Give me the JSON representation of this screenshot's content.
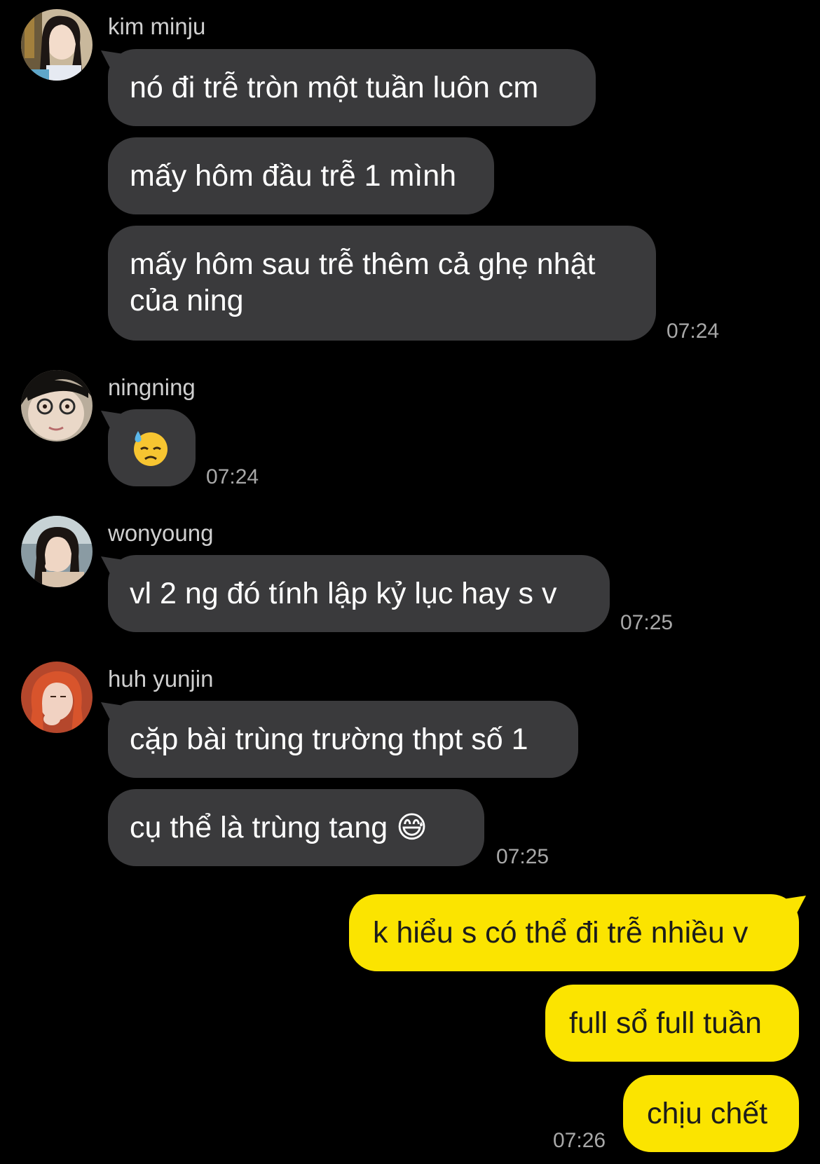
{
  "messages_incoming": [
    {
      "sender": "kim minju",
      "bubbles": [
        "nó đi trễ tròn một tuần luôn cm",
        "mấy hôm đầu trễ 1 mình",
        "mấy hôm sau trễ thêm cả ghẹ nhật của ning"
      ],
      "time": "07:24"
    },
    {
      "sender": "ningning",
      "bubbles": [
        "😓"
      ],
      "time": "07:24"
    },
    {
      "sender": "wonyoung",
      "bubbles": [
        "vl 2 ng đó tính lập kỷ lục hay s v"
      ],
      "time": "07:25"
    },
    {
      "sender": "huh yunjin",
      "bubbles": [
        "cặp bài trùng trường thpt số 1",
        "cụ thể là trùng tang 😅"
      ],
      "time": "07:25"
    }
  ],
  "messages_outgoing": {
    "bubbles": [
      "k hiểu s có thể đi trễ nhiều v",
      "full sổ full tuần",
      "chịu chết"
    ],
    "time": "07:26"
  },
  "colors": {
    "background": "#000000",
    "incoming_bubble": "#3a3a3c",
    "outgoing_bubble": "#fbe400"
  },
  "icons": {
    "avatars": [
      "avatar-kim-minju",
      "avatar-ningning",
      "avatar-wonyoung",
      "avatar-huh-yunjin"
    ]
  }
}
